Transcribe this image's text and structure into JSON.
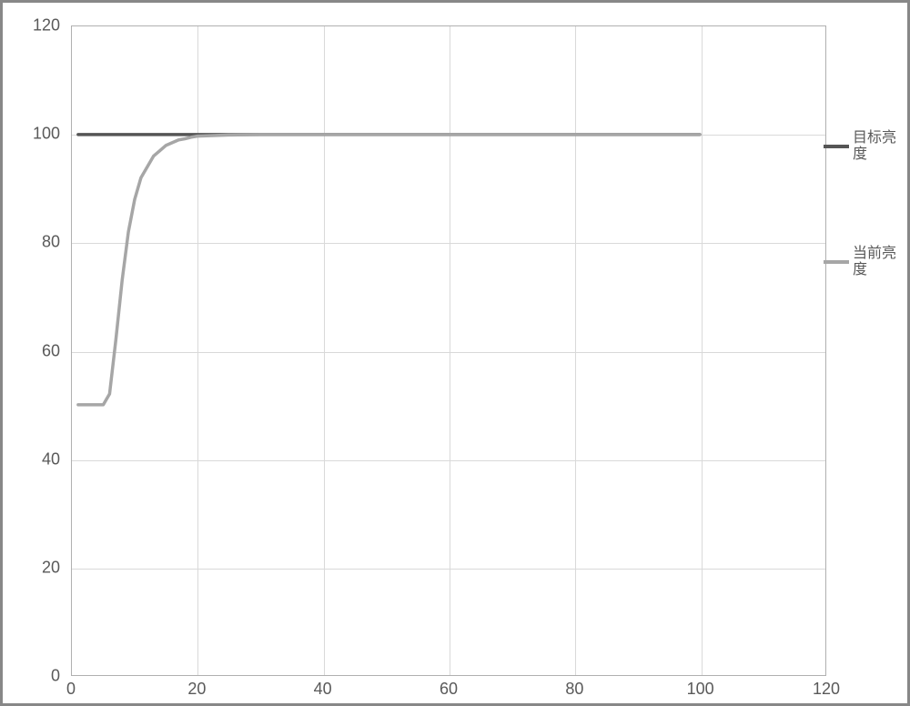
{
  "chart_data": {
    "type": "line",
    "xlabel": "",
    "ylabel": "",
    "title": "",
    "xlim": [
      0,
      120
    ],
    "ylim": [
      0,
      120
    ],
    "xticks": [
      0,
      20,
      40,
      60,
      80,
      100,
      120
    ],
    "yticks": [
      0,
      20,
      40,
      60,
      80,
      100,
      120
    ],
    "grid": true,
    "legend_position": "right",
    "series": [
      {
        "name": "目标亮度",
        "color": "#555555",
        "x": [
          1,
          2,
          3,
          4,
          5,
          6,
          7,
          8,
          9,
          10,
          11,
          12,
          13,
          14,
          15,
          16,
          17,
          18,
          19,
          20,
          25,
          30,
          40,
          50,
          60,
          70,
          80,
          90,
          100
        ],
        "y": [
          100,
          100,
          100,
          100,
          100,
          100,
          100,
          100,
          100,
          100,
          100,
          100,
          100,
          100,
          100,
          100,
          100,
          100,
          100,
          100,
          100,
          100,
          100,
          100,
          100,
          100,
          100,
          100,
          100
        ]
      },
      {
        "name": "当前亮度",
        "color": "#a6a6a6",
        "x": [
          1,
          2,
          3,
          4,
          5,
          6,
          7,
          8,
          9,
          10,
          11,
          12,
          13,
          14,
          15,
          16,
          17,
          18,
          19,
          20,
          25,
          30,
          40,
          50,
          60,
          70,
          80,
          90,
          100
        ],
        "y": [
          50,
          50,
          50,
          50,
          50,
          52,
          62,
          73,
          82,
          88,
          92,
          94,
          96,
          97,
          98,
          98.5,
          99,
          99.2,
          99.5,
          99.7,
          99.9,
          100,
          100,
          100,
          100,
          100,
          100,
          100,
          100
        ]
      }
    ]
  },
  "legend": {
    "items": [
      {
        "label": "目标亮度",
        "color": "#555555"
      },
      {
        "label": "当前亮度",
        "color": "#a6a6a6"
      }
    ]
  },
  "axes": {
    "yticks": [
      "0",
      "20",
      "40",
      "60",
      "80",
      "100",
      "120"
    ],
    "xticks": [
      "0",
      "20",
      "40",
      "60",
      "80",
      "100",
      "120"
    ]
  }
}
